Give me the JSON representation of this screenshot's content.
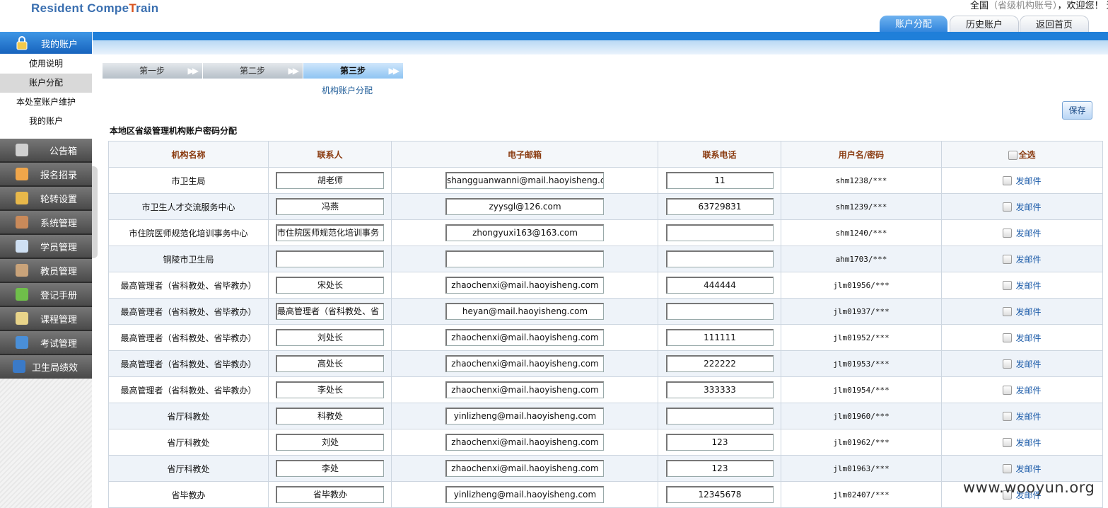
{
  "app": {
    "title_part1": "Resident Compe",
    "title_part2": "T",
    "title_part3": "rain"
  },
  "header": {
    "welcome_main": "全国",
    "welcome_sub": "（省级机构账号）",
    "welcome_tail": "，欢迎您！ 退"
  },
  "top_tabs": [
    {
      "label": "账户分配"
    },
    {
      "label": "历史账户"
    },
    {
      "label": "返回首页"
    }
  ],
  "sidebar": {
    "head": "我的账户",
    "sub_items": [
      {
        "label": "使用说明"
      },
      {
        "label": "账户分配"
      },
      {
        "label": "本处室账户维护"
      },
      {
        "label": "我的账户"
      }
    ],
    "groups": [
      {
        "label": "公告箱"
      },
      {
        "label": "报名招录"
      },
      {
        "label": "轮转设置"
      },
      {
        "label": "系统管理"
      },
      {
        "label": "学员管理"
      },
      {
        "label": "教员管理"
      },
      {
        "label": "登记手册"
      },
      {
        "label": "课程管理"
      },
      {
        "label": "考试管理"
      },
      {
        "label": "卫生局绩效"
      }
    ]
  },
  "steps": [
    {
      "label": "第一步"
    },
    {
      "label": "第二步"
    },
    {
      "label": "第三步"
    }
  ],
  "step_subtitle": "机构账户分配",
  "save_label": "保存",
  "section_title": "本地区省级管理机构账户密码分配",
  "table": {
    "headers": [
      "机构名称",
      "联系人",
      "电子邮箱",
      "联系电话",
      "用户名/密码",
      "全选"
    ],
    "mail_label": "发邮件",
    "rows": [
      {
        "org": "市卫生局",
        "contact": "胡老师",
        "email": "shangguanwanni@mail.haoyisheng.co",
        "phone": "11",
        "user": "shm1238/***"
      },
      {
        "org": "市卫生人才交流服务中心",
        "contact": "冯燕",
        "email": "zyysgl@126.com",
        "phone": "63729831",
        "user": "shm1239/***"
      },
      {
        "org": "市住院医师规范化培训事务中心",
        "contact": "市住院医师规范化培训事务",
        "email": "zhongyuxi163@163.com",
        "phone": "",
        "user": "shm1240/***"
      },
      {
        "org": "铜陵市卫生局",
        "contact": "",
        "email": "",
        "phone": "",
        "user": "ahm1703/***"
      },
      {
        "org": "最高管理者（省科教处、省毕教办）",
        "contact": "宋处长",
        "email": "zhaochenxi@mail.haoyisheng.com",
        "phone": "444444",
        "user": "jlm01956/***"
      },
      {
        "org": "最高管理者（省科教处、省毕教办）",
        "contact": "最高管理者（省科教处、省",
        "email": "heyan@mail.haoyisheng.com",
        "phone": "",
        "user": "jlm01937/***"
      },
      {
        "org": "最高管理者（省科教处、省毕教办）",
        "contact": "刘处长",
        "email": "zhaochenxi@mail.haoyisheng.com",
        "phone": "111111",
        "user": "jlm01952/***"
      },
      {
        "org": "最高管理者（省科教处、省毕教办）",
        "contact": "高处长",
        "email": "zhaochenxi@mail.haoyisheng.com",
        "phone": "222222",
        "user": "jlm01953/***"
      },
      {
        "org": "最高管理者（省科教处、省毕教办）",
        "contact": "李处长",
        "email": "zhaochenxi@mail.haoyisheng.com",
        "phone": "333333",
        "user": "jlm01954/***"
      },
      {
        "org": "省厅科教处",
        "contact": "科教处",
        "email": "yinlizheng@mail.haoyisheng.com",
        "phone": "",
        "user": "jlm01960/***"
      },
      {
        "org": "省厅科教处",
        "contact": "刘处",
        "email": "zhaochenxi@mail.haoyisheng.com",
        "phone": "123",
        "user": "jlm01962/***"
      },
      {
        "org": "省厅科教处",
        "contact": "李处",
        "email": "zhaochenxi@mail.haoyisheng.com",
        "phone": "123",
        "user": "jlm01963/***"
      },
      {
        "org": "省毕教办",
        "contact": "省毕教办",
        "email": "yinlizheng@mail.haoyisheng.com",
        "phone": "12345678",
        "user": "jlm02407/***"
      }
    ]
  },
  "watermark": "www.wooyun.org"
}
